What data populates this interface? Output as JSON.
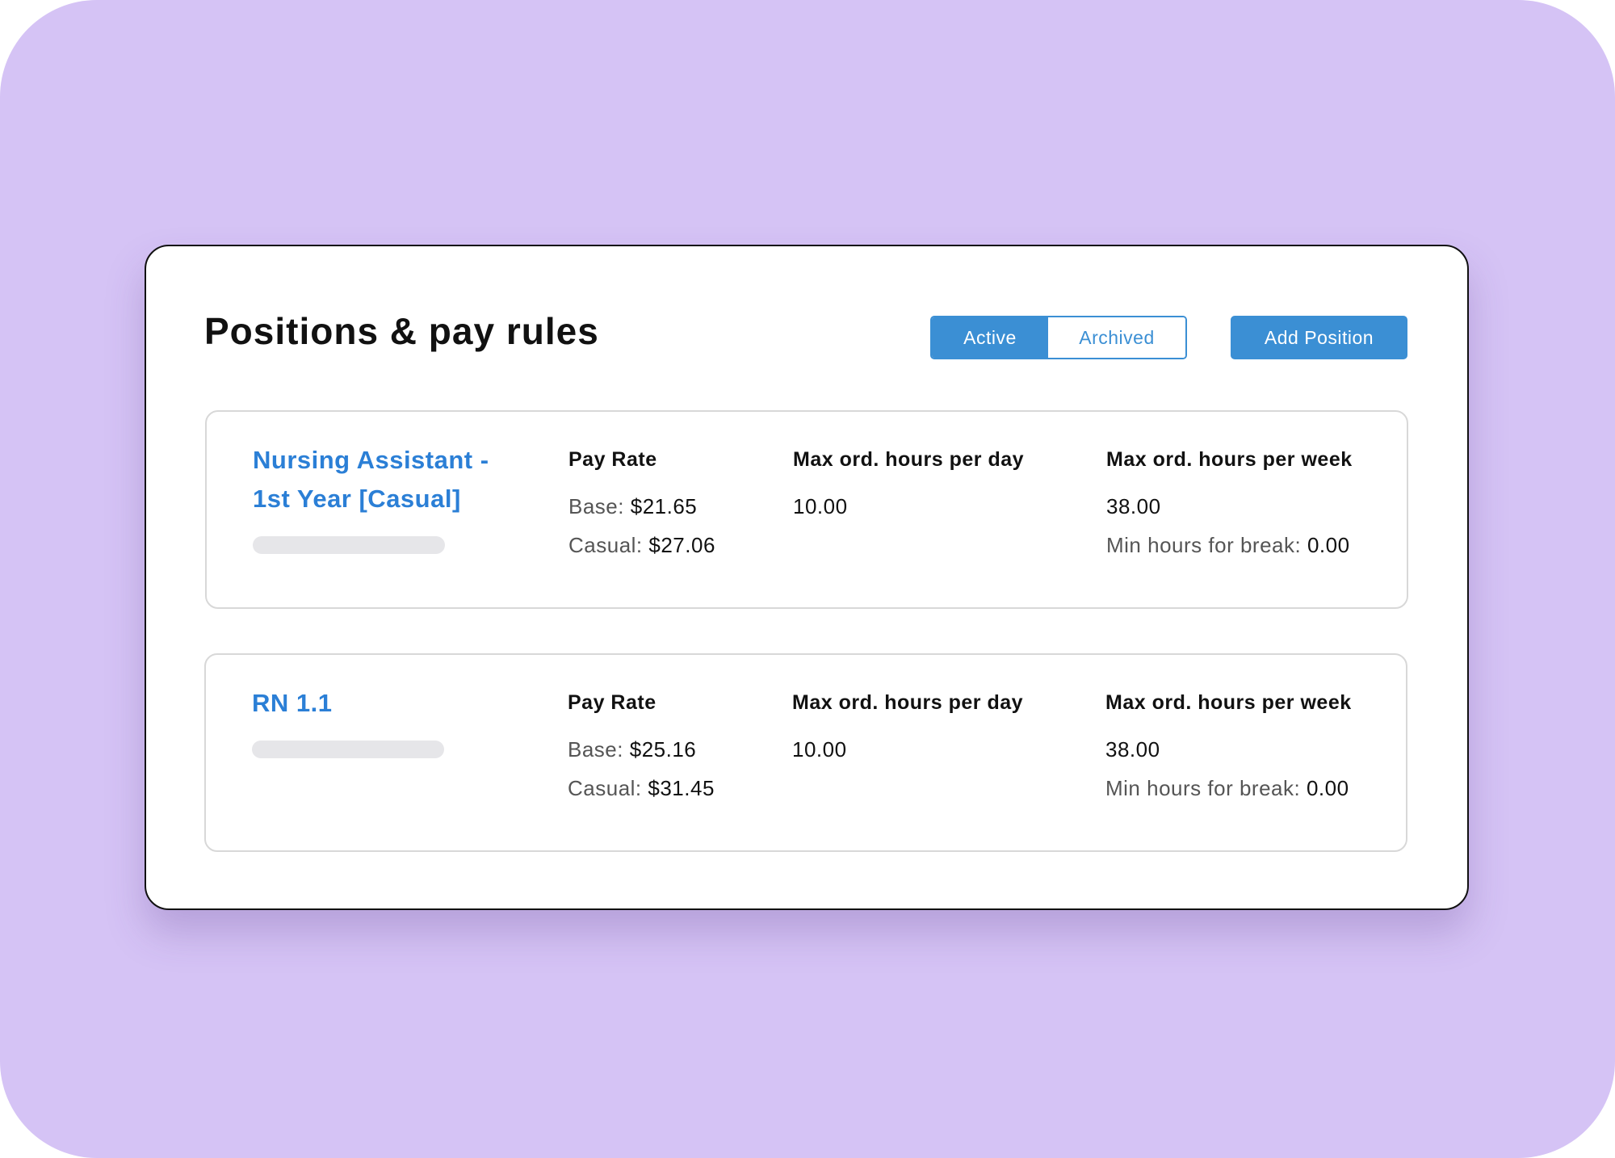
{
  "page": {
    "title": "Positions & pay rules"
  },
  "filter": {
    "active_label": "Active",
    "archived_label": "Archived",
    "selected": "Active"
  },
  "actions": {
    "add_position_label": "Add Position"
  },
  "columns": {
    "pay_rate": "Pay Rate",
    "max_day": "Max ord. hours per day",
    "max_week": "Max ord. hours per week",
    "base_label": "Base:",
    "casual_label": "Casual:",
    "min_break_label": "Min hours for break:"
  },
  "positions": [
    {
      "name": "Nursing Assistant - 1st Year [Casual]",
      "base_rate": "$21.65",
      "casual_rate": "$27.06",
      "max_hours_day": "10.00",
      "max_hours_week": "38.00",
      "min_hours_break": "0.00"
    },
    {
      "name": "RN 1.1",
      "base_rate": "$25.16",
      "casual_rate": "$31.45",
      "max_hours_day": "10.00",
      "max_hours_week": "38.00",
      "min_hours_break": "0.00"
    }
  ],
  "colors": {
    "background": "#d5c3f5",
    "accent": "#3b8fd4",
    "link": "#2b7fd6"
  }
}
